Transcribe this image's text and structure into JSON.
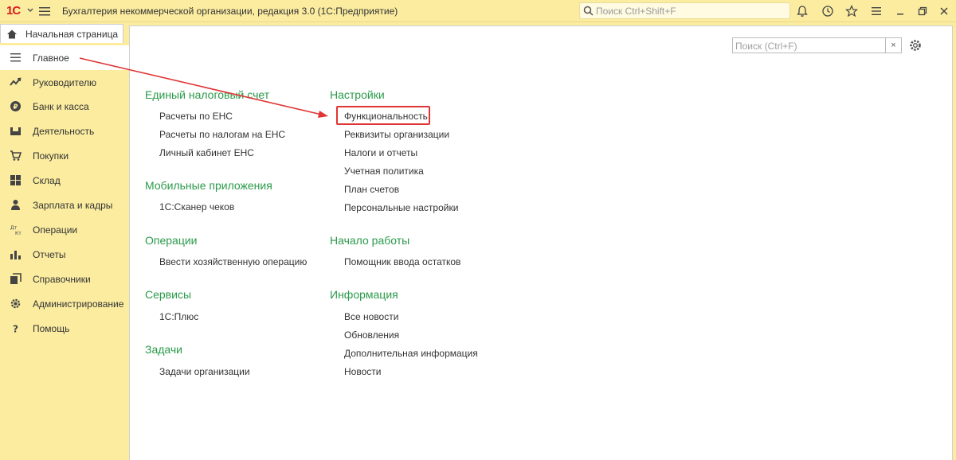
{
  "titlebar": {
    "logo_text": "1С",
    "app_title": "Бухгалтерия некоммерческой организации, редакция 3.0  (1С:Предприятие)",
    "search_placeholder": "Поиск Ctrl+Shift+F",
    "icons": [
      "bell-icon",
      "history-icon",
      "star-icon",
      "menu-icon",
      "minimize-icon",
      "restore-icon",
      "close-icon"
    ]
  },
  "tabs": {
    "home_label": "Начальная страница"
  },
  "sidebar": {
    "items": [
      {
        "label": "Главное",
        "icon": "lines-icon",
        "active": true
      },
      {
        "label": "Руководителю",
        "icon": "trend-icon"
      },
      {
        "label": "Банк и касса",
        "icon": "ruble-icon"
      },
      {
        "label": "Деятельность",
        "icon": "activity-icon"
      },
      {
        "label": "Покупки",
        "icon": "cart-icon"
      },
      {
        "label": "Склад",
        "icon": "warehouse-icon"
      },
      {
        "label": "Зарплата и кадры",
        "icon": "person-icon"
      },
      {
        "label": "Операции",
        "icon": "operations-icon"
      },
      {
        "label": "Отчеты",
        "icon": "bars-icon"
      },
      {
        "label": "Справочники",
        "icon": "books-icon"
      },
      {
        "label": "Администрирование",
        "icon": "gear-icon"
      },
      {
        "label": "Помощь",
        "icon": "question-icon"
      }
    ]
  },
  "content": {
    "search_placeholder": "Поиск (Ctrl+F)",
    "clear_label": "×",
    "left_sections": [
      {
        "title": "Единый налоговый счет",
        "links": [
          "Расчеты по ЕНС",
          "Расчеты по налогам на ЕНС",
          "Личный кабинет ЕНС"
        ]
      },
      {
        "title": "Мобильные приложения",
        "links": [
          "1С:Сканер чеков"
        ]
      },
      {
        "title": "Операции",
        "links": [
          "Ввести хозяйственную операцию"
        ]
      },
      {
        "title": "Сервисы",
        "links": [
          "1С:Плюс"
        ]
      },
      {
        "title": "Задачи",
        "links": [
          "Задачи организации"
        ]
      }
    ],
    "right_sections": [
      {
        "title": "Настройки",
        "links": [
          "Функциональность",
          "Реквизиты организации",
          "Налоги и отчеты",
          "Учетная политика",
          "План счетов",
          "Персональные настройки"
        ]
      },
      {
        "title": "Начало работы",
        "links": [
          "Помощник ввода остатков"
        ]
      },
      {
        "title": "Информация",
        "links": [
          "Все новости",
          "Обновления",
          "Дополнительная информация",
          "Новости"
        ]
      }
    ]
  },
  "annotation": {
    "color": "#e03535",
    "highlighted": "Функциональность"
  }
}
